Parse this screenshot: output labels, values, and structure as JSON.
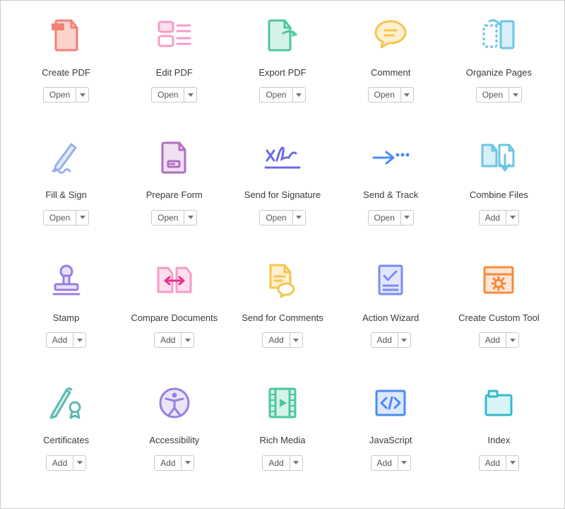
{
  "tools": [
    {
      "id": "create-pdf",
      "label": "Create PDF",
      "action": "Open",
      "icon": "create-pdf-icon"
    },
    {
      "id": "edit-pdf",
      "label": "Edit PDF",
      "action": "Open",
      "icon": "edit-pdf-icon"
    },
    {
      "id": "export-pdf",
      "label": "Export PDF",
      "action": "Open",
      "icon": "export-pdf-icon"
    },
    {
      "id": "comment",
      "label": "Comment",
      "action": "Open",
      "icon": "comment-icon"
    },
    {
      "id": "organize-pages",
      "label": "Organize Pages",
      "action": "Open",
      "icon": "organize-pages-icon"
    },
    {
      "id": "fill-sign",
      "label": "Fill & Sign",
      "action": "Open",
      "icon": "fill-sign-icon"
    },
    {
      "id": "prepare-form",
      "label": "Prepare Form",
      "action": "Open",
      "icon": "prepare-form-icon"
    },
    {
      "id": "send-signature",
      "label": "Send for Signature",
      "action": "Open",
      "icon": "send-signature-icon"
    },
    {
      "id": "send-track",
      "label": "Send & Track",
      "action": "Open",
      "icon": "send-track-icon"
    },
    {
      "id": "combine-files",
      "label": "Combine Files",
      "action": "Add",
      "icon": "combine-files-icon"
    },
    {
      "id": "stamp",
      "label": "Stamp",
      "action": "Add",
      "icon": "stamp-icon"
    },
    {
      "id": "compare-documents",
      "label": "Compare Documents",
      "action": "Add",
      "icon": "compare-documents-icon"
    },
    {
      "id": "send-comments",
      "label": "Send for Comments",
      "action": "Add",
      "icon": "send-comments-icon"
    },
    {
      "id": "action-wizard",
      "label": "Action Wizard",
      "action": "Add",
      "icon": "action-wizard-icon"
    },
    {
      "id": "custom-tool",
      "label": "Create Custom Tool",
      "action": "Add",
      "icon": "custom-tool-icon"
    },
    {
      "id": "certificates",
      "label": "Certificates",
      "action": "Add",
      "icon": "certificates-icon"
    },
    {
      "id": "accessibility",
      "label": "Accessibility",
      "action": "Add",
      "icon": "accessibility-icon"
    },
    {
      "id": "rich-media",
      "label": "Rich Media",
      "action": "Add",
      "icon": "rich-media-icon"
    },
    {
      "id": "javascript",
      "label": "JavaScript",
      "action": "Add",
      "icon": "javascript-icon"
    },
    {
      "id": "index",
      "label": "Index",
      "action": "Add",
      "icon": "index-icon"
    }
  ],
  "colors": {
    "red": "#f28277",
    "pink": "#f49cc8",
    "green": "#4bc7a2",
    "yellow": "#f6c44f",
    "cyan": "#6cc6e4",
    "blue": "#4a8bf4",
    "purple": "#b06fc1",
    "indigo": "#6a6ae0",
    "violet": "#9a7de0",
    "orange": "#f58b3c",
    "teal": "#5cb9b2",
    "lightcyan": "#b7ecef"
  }
}
